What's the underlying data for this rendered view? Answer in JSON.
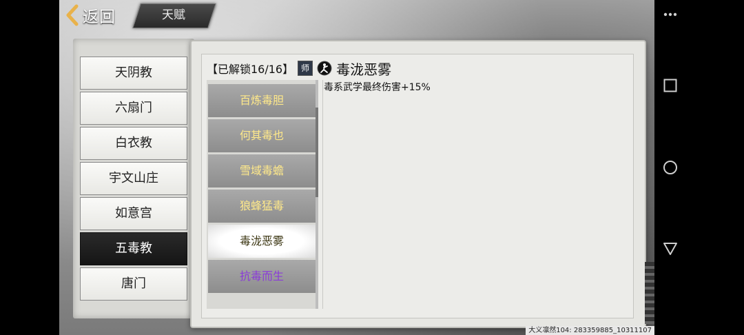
{
  "header": {
    "back_label": "返回",
    "tab_label": "天赋"
  },
  "sects": {
    "selected_index": 5,
    "items": [
      "天阴教",
      "六扇门",
      "白衣教",
      "宇文山庄",
      "如意宫",
      "五毒教",
      "唐门"
    ]
  },
  "talent_detail": {
    "unlock_label": "【已解锁16/16】",
    "tier_badge": "师",
    "stance_icon": "martial-stance-icon",
    "title": "毒泷恶雾",
    "description": "毒系武学最终伤害+15%"
  },
  "talents": {
    "selected_index": 4,
    "items": [
      {
        "label": "百炼毒胆",
        "color": "#ffe98a"
      },
      {
        "label": "何其毒也",
        "color": "#ffe98a"
      },
      {
        "label": "雪域毒蟾",
        "color": "#ffe98a"
      },
      {
        "label": "狼蜂猛毒",
        "color": "#ffe98a"
      },
      {
        "label": "毒泷恶雾",
        "color": "#3a3410"
      },
      {
        "label": "抗毒而生",
        "color": "#8a3bd8"
      }
    ]
  },
  "footer": {
    "info": "大义凛然104: 283359885_10311107"
  },
  "android_nav": {
    "icons": [
      "menu-dots-icon",
      "recents-square-icon",
      "home-circle-icon",
      "back-triangle-icon"
    ]
  },
  "colors": {
    "talent_text_gold": "#ffe98a",
    "talent_text_purple": "#8a3bd8",
    "selected_sect_bg": "#1a1a1a"
  }
}
